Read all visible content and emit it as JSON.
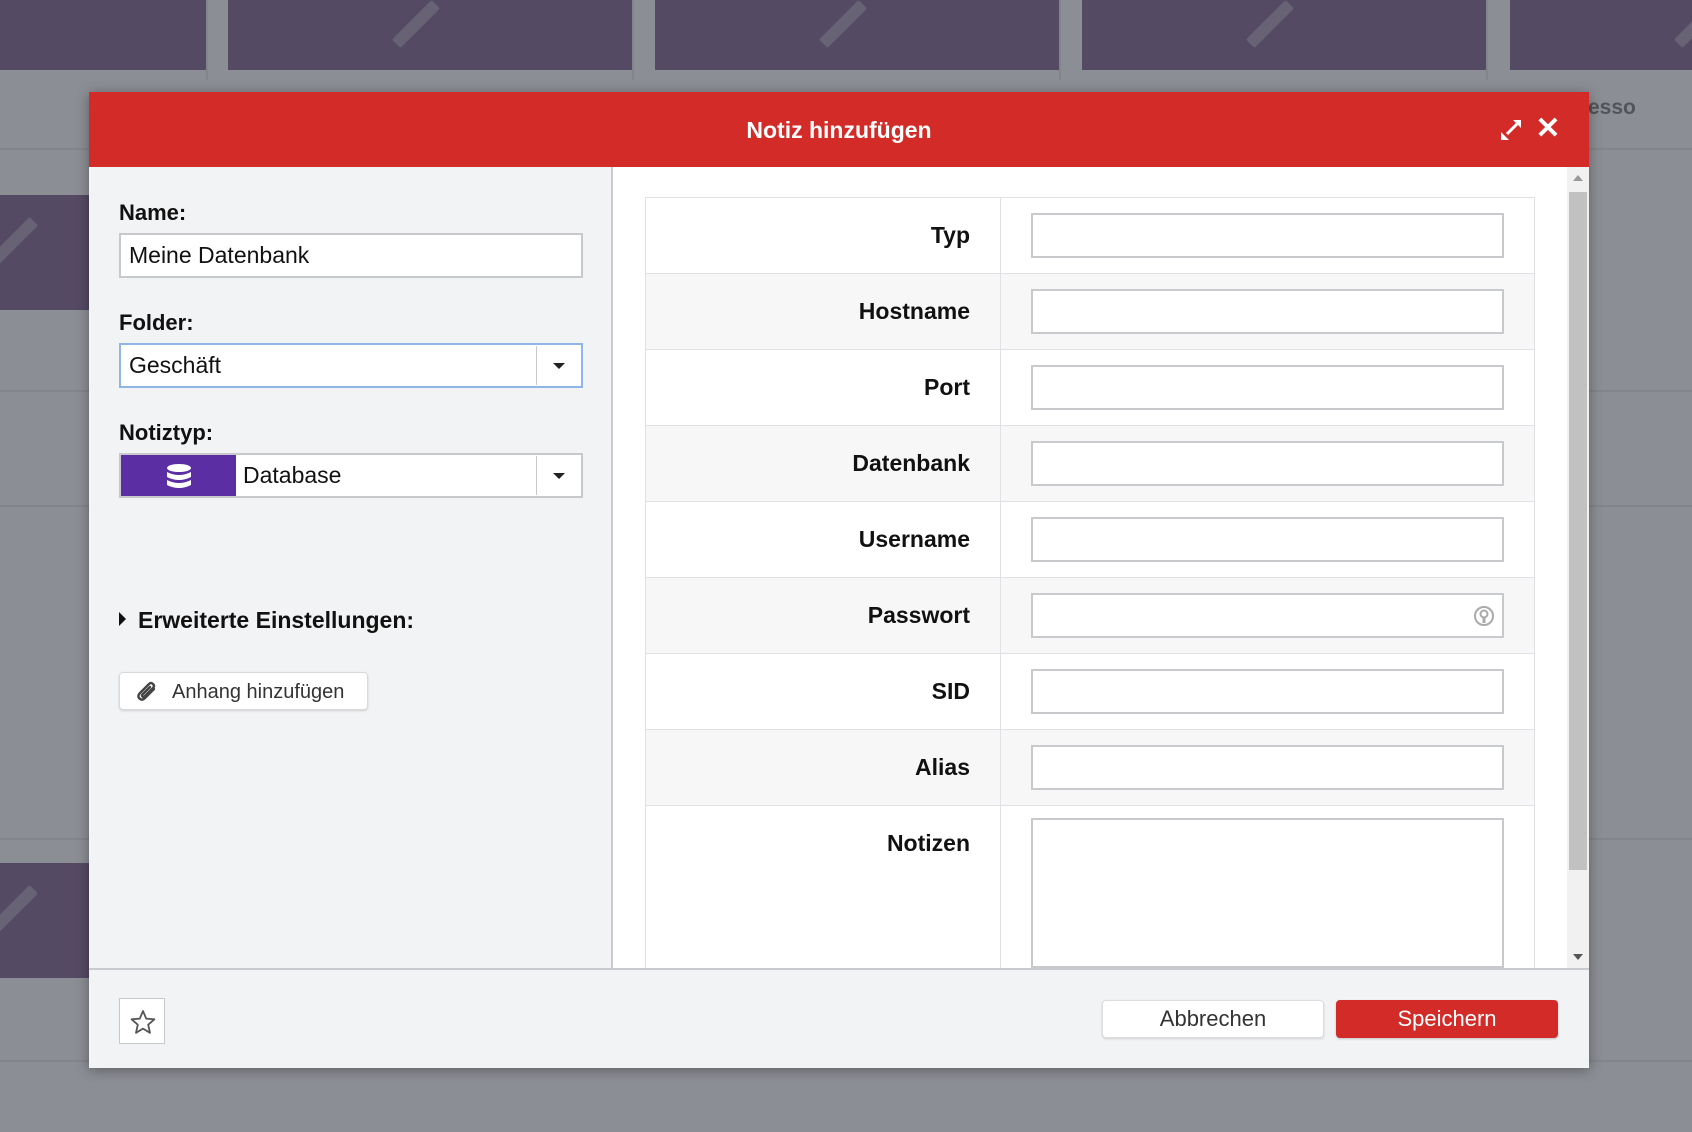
{
  "background": {
    "partial_text": "esso"
  },
  "dialog": {
    "title": "Notiz hinzufügen",
    "expand_icon": "expand-icon",
    "close_icon": "close-icon",
    "close_glyph": "✕",
    "accent_color": "#d32b27"
  },
  "left": {
    "name_label": "Name:",
    "name_value": "Meine Datenbank",
    "folder_label": "Folder:",
    "folder_value": "Geschäft",
    "type_label": "Notiztyp:",
    "type_value": "Database",
    "type_icon": "database-icon",
    "type_color": "#5b2fa3",
    "advanced_label": "Erweiterte Einstellungen:",
    "attach_label": "Anhang hinzufügen",
    "attach_icon": "paperclip-icon"
  },
  "fields": [
    {
      "label": "Typ",
      "value": ""
    },
    {
      "label": "Hostname",
      "value": ""
    },
    {
      "label": "Port",
      "value": ""
    },
    {
      "label": "Datenbank",
      "value": ""
    },
    {
      "label": "Username",
      "value": ""
    },
    {
      "label": "Passwort",
      "value": ""
    },
    {
      "label": "SID",
      "value": ""
    },
    {
      "label": "Alias",
      "value": ""
    },
    {
      "label": "Notizen",
      "value": ""
    }
  ],
  "footer": {
    "favorite_icon": "star-icon",
    "cancel_label": "Abbrechen",
    "save_label": "Speichern"
  }
}
